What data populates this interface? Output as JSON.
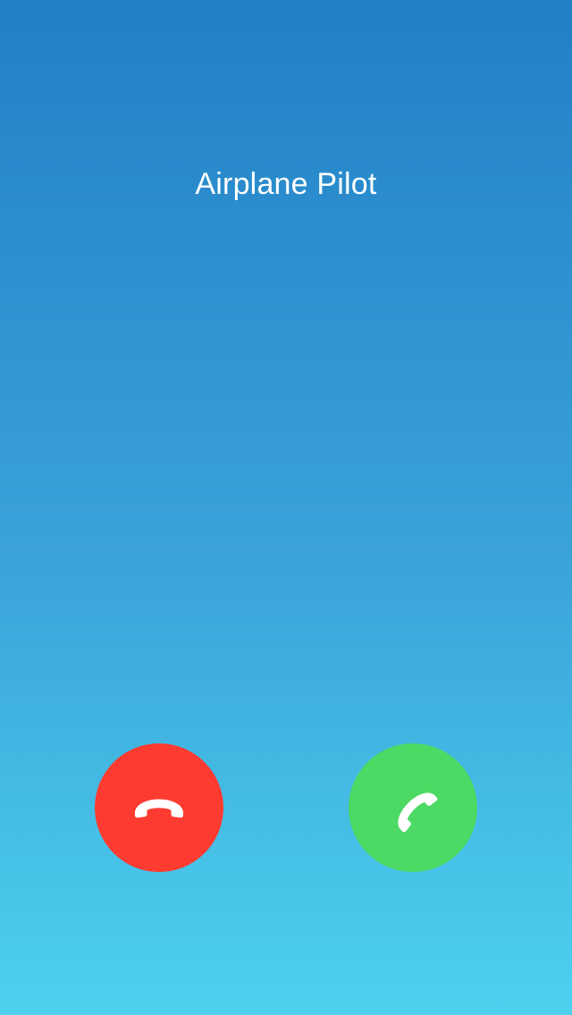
{
  "call": {
    "caller_name": "Airplane Pilot"
  },
  "actions": {
    "decline": {
      "icon": "phone-hangup-icon",
      "color": "#fe3b30"
    },
    "accept": {
      "icon": "phone-icon",
      "color": "#4cd964"
    }
  },
  "colors": {
    "background_top": "#2180c6",
    "background_bottom": "#4dd1ef",
    "text": "#ffffff"
  }
}
